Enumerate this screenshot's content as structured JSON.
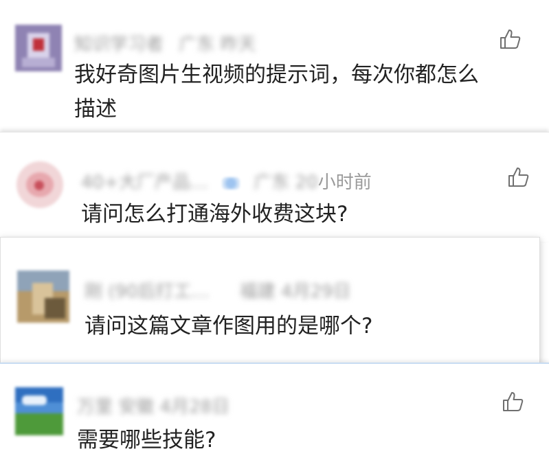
{
  "comments": [
    {
      "meta_blurred_1": "知识学习者",
      "meta_blurred_2": "广东 昨天",
      "lines": [
        "我好奇图片生视频的提示词，每次你都怎么",
        "描述"
      ],
      "like_icon": "thumbs-up-icon"
    },
    {
      "meta_blurred_1": "40+大厂产品…",
      "meta_blurred_2": "广东 20",
      "meta_clear": "小时前",
      "lines": [
        "请问怎么打通海外收费这块?"
      ],
      "like_icon": "thumbs-up-icon"
    },
    {
      "meta_blurred_1": "刚 (90后打工…",
      "meta_blurred_2": "福建 4月29日",
      "lines": [
        "请问这篇文章作图用的是哪个?"
      ]
    },
    {
      "meta_blurred_1": "万里 安徽 4月28日",
      "lines": [
        "需要哪些技能?"
      ],
      "like_icon": "thumbs-up-icon"
    }
  ],
  "colors": {
    "text": "#222222",
    "meta": "#b0b0b0",
    "icon": "#6f6f6f"
  }
}
